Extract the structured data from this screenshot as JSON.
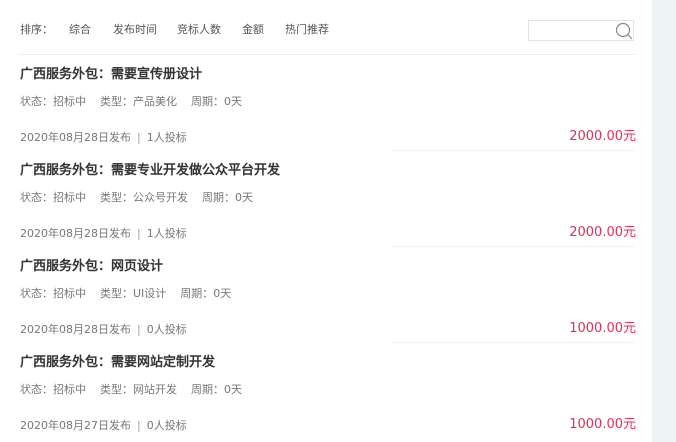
{
  "sort": {
    "label": "排序：",
    "options": [
      "综合",
      "发布时间",
      "竞标人数",
      "金额",
      "热门推荐"
    ]
  },
  "search": {
    "value": "",
    "placeholder": ""
  },
  "colors": {
    "price": "#e0305a",
    "page_bg": "#eef4f4"
  },
  "items": [
    {
      "title": "广西服务外包：需要宣传册设计",
      "status_label": "状态：",
      "status": "招标中",
      "type_label": "类型：",
      "type": "产品美化",
      "period_label": "周期：",
      "period": "0天",
      "date": "2020年08月28日发布",
      "bids": "1人投标",
      "price": "2000.00元"
    },
    {
      "title": "广西服务外包：需要专业开发做公众平台开发",
      "status_label": "状态：",
      "status": "招标中",
      "type_label": "类型：",
      "type": "公众号开发",
      "period_label": "周期：",
      "period": "0天",
      "date": "2020年08月28日发布",
      "bids": "1人投标",
      "price": "2000.00元"
    },
    {
      "title": "广西服务外包：网页设计",
      "status_label": "状态：",
      "status": "招标中",
      "type_label": "类型：",
      "type": "UI设计",
      "period_label": "周期：",
      "period": "0天",
      "date": "2020年08月28日发布",
      "bids": "0人投标",
      "price": "1000.00元"
    },
    {
      "title": "广西服务外包：需要网站定制开发",
      "status_label": "状态：",
      "status": "招标中",
      "type_label": "类型：",
      "type": "网站开发",
      "period_label": "周期：",
      "period": "0天",
      "date": "2020年08月27日发布",
      "bids": "0人投标",
      "price": "1000.00元"
    }
  ]
}
